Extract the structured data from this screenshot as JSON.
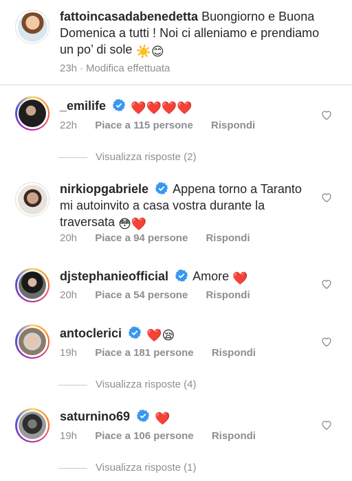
{
  "caption": {
    "username": "fattoincasadabenedetta",
    "text": "Buongiorno e Buona Domenica a tutti ! Noi ci alleniamo e prendiamo un po’ di sole",
    "emoji": "☀️😊",
    "time": "23h",
    "edited": "Modifica effettuata"
  },
  "comments": [
    {
      "username": "_emilife",
      "text": "",
      "emoji": "❤️❤️❤️❤️",
      "time": "22h",
      "likes": "Piace a 115 persone",
      "reply": "Rispondi",
      "view_replies": "Visualizza risposte (2)",
      "avatar_color": "#3a3a3a"
    },
    {
      "username": "nirkiopgabriele",
      "text": "Appena torno a Taranto mi autoinvito a casa vostra durante la traversata",
      "emoji": "😳❤️",
      "time": "20h",
      "likes": "Piace a 94 persone",
      "reply": "Rispondi",
      "avatar_color": "#5b4636"
    },
    {
      "username": "djstephanieofficial",
      "text": "Amore",
      "emoji": "❤️",
      "time": "20h",
      "likes": "Piace a 54 persone",
      "reply": "Rispondi",
      "avatar_color": "#2c2c2c"
    },
    {
      "username": "antoclerici",
      "text": "",
      "emoji": "❤️😪",
      "time": "19h",
      "likes": "Piace a 181 persone",
      "reply": "Rispondi",
      "view_replies": "Visualizza risposte (4)",
      "avatar_color": "#b99a7a"
    },
    {
      "username": "saturnino69",
      "text": "",
      "emoji": "❤️",
      "time": "19h",
      "likes": "Piace a 106 persone",
      "reply": "Rispondi",
      "view_replies": "Visualizza risposte (1)",
      "avatar_color": "#4a4a4a"
    }
  ],
  "colors": {
    "verified_blue": "#3897f0",
    "meta_gray": "#8e8e8e",
    "heart_red": "#ed4956"
  },
  "icons": {
    "verified": "verified-badge-icon",
    "like": "heart-outline-icon"
  }
}
